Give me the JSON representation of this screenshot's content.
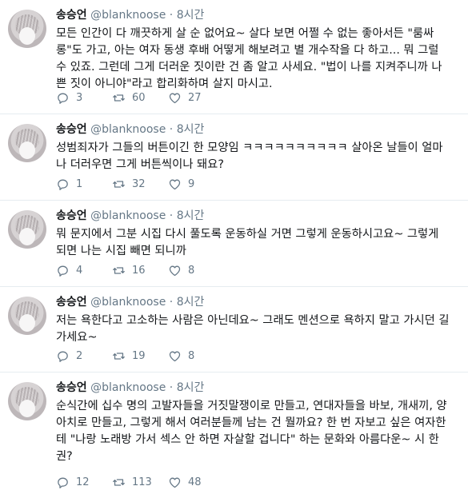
{
  "tweets": [
    {
      "name": "송승언",
      "handle": "@blanknoose",
      "dot": "·",
      "time": "8시간",
      "text": "모든 인간이 다 깨끗하게 살 순 없어요~ 살다 보면 어쩔 수 없는 좋아서든 \"룸싸롱\"도 가고, 아는 여자 동생 후배 어떻게 해보려고 별 개수작을 다 하고... 뭐 그럴 수 있죠. 그런데 그게 더러운 짓이란 건 좀 알고 사세요. \"법이 나를 지켜주니까 나쁜 짓이 아니야\"라고 합리화하며 살지 마시고.",
      "replies": "3",
      "retweets": "60",
      "likes": "27"
    },
    {
      "name": "송승언",
      "handle": "@blanknoose",
      "dot": "·",
      "time": "8시간",
      "text": "성범죄자가 그들의 버튼이긴 한 모양임 ㅋㅋㅋㅋㅋㅋㅋㅋㅋㅋ 살아온 날들이 얼마나 더러우면 그게 버튼씩이나 돼요?",
      "replies": "1",
      "retweets": "32",
      "likes": "9"
    },
    {
      "name": "송승언",
      "handle": "@blanknoose",
      "dot": "·",
      "time": "8시간",
      "text": "뭐 문지에서 그분 시집 다시 풀도록 운동하실 거면 그렇게 운동하시고요~ 그렇게 되면 나는 시집 빼면 되니까",
      "replies": "4",
      "retweets": "16",
      "likes": "8"
    },
    {
      "name": "송승언",
      "handle": "@blanknoose",
      "dot": "·",
      "time": "8시간",
      "text": "저는 욕한다고 고소하는 사람은 아닌데요~ 그래도 멘션으로 욕하지 말고 가시던 길 가세요~",
      "replies": "2",
      "retweets": "19",
      "likes": "8"
    },
    {
      "name": "송승언",
      "handle": "@blanknoose",
      "dot": "·",
      "time": "8시간",
      "text": "순식간에 십수 명의 고발자들을 거짓말쟁이로 만들고, 연대자들을 바보, 개새끼, 양아치로 만들고, 그렇게 해서 여러분들께 남는 건 뭘까요? 한 번 자보고 싶은 여자한테 \"나랑 노래방 가서 섹스 안 하면 자살할 겁니다\" 하는 문화와 아름다운~ 시 한 권?",
      "replies": "12",
      "retweets": "113",
      "likes": "48"
    }
  ],
  "icons": {
    "reply": "reply-icon",
    "retweet": "retweet-icon",
    "like": "heart-icon",
    "avatar": "avatar-image"
  },
  "colors": {
    "text": "#14171a",
    "meta": "#657786",
    "divider": "#e6ecf0"
  }
}
